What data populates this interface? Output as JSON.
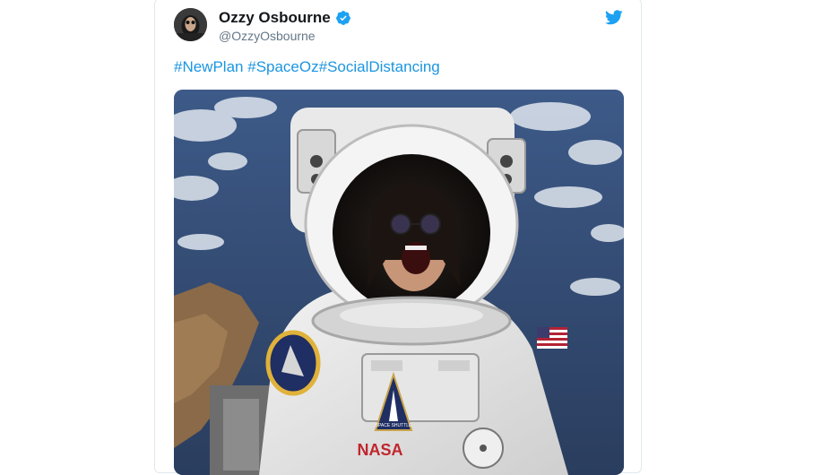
{
  "tweet": {
    "author_name": "Ozzy Osbourne",
    "author_handle": "@OzzyOsbourne",
    "hashtags": [
      "#NewPlan",
      "#SpaceOz",
      "#SocialDistancing"
    ],
    "media_patch_text": "SPACE SHUTTLE",
    "media_logo_text": "NASA"
  },
  "icons": {
    "verified": "verified-badge-icon",
    "brand": "twitter-bird-icon"
  },
  "colors": {
    "link": "#1b95e0",
    "name": "#14171a",
    "handle": "#657786",
    "verified": "#1da1f2",
    "border": "#e1e8ed"
  }
}
